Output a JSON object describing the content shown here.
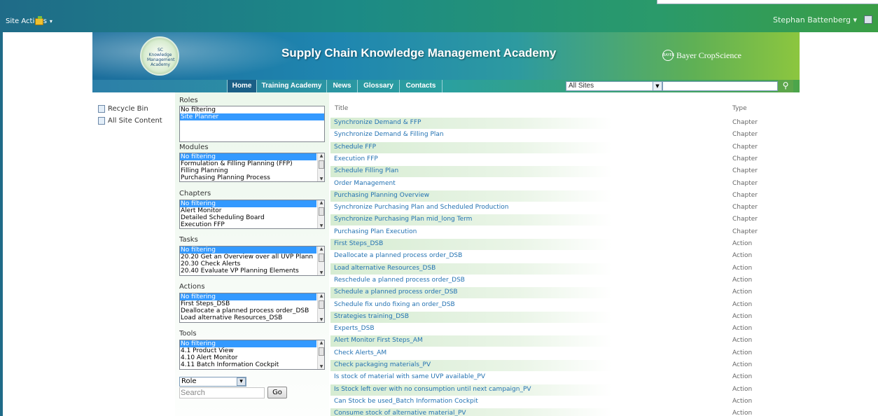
{
  "topbar": {
    "site_actions": "Site Actions",
    "user": "Stephan Battenberg"
  },
  "banner": {
    "title": "Supply Chain Knowledge Management Academy",
    "logo_text": "SC Knowledge Management Academy",
    "brand": "Bayer CropScience"
  },
  "nav": {
    "items": [
      "Home",
      "Training Academy",
      "News",
      "Glossary",
      "Contacts"
    ],
    "active": "Home",
    "scope_value": "All Sites"
  },
  "left_links": [
    "Recycle Bin",
    "All Site Content"
  ],
  "filters": {
    "roles": {
      "label": "Roles",
      "options": [
        "No filtering",
        "Site Planner"
      ],
      "selected": "Site Planner"
    },
    "modules": {
      "label": "Modules",
      "options": [
        "No filtering",
        "Formulation & Filling Planning (FFP)",
        "Filling Planning",
        "Purchasing Planning Process"
      ],
      "selected": "No filtering"
    },
    "chapters": {
      "label": "Chapters",
      "options": [
        "No filtering",
        "Alert Monitor",
        "Detailed Scheduling Board",
        "Execution FFP"
      ],
      "selected": "No filtering"
    },
    "tasks": {
      "label": "Tasks",
      "options": [
        "No filtering",
        "20.20 Get an Overview over all UVP Plann",
        "20.30 Check Alerts",
        "20.40 Evaluate VP Planning Elements"
      ],
      "selected": "No filtering"
    },
    "actions": {
      "label": "Actions",
      "options": [
        "No filtering",
        "First Steps_DSB",
        "Deallocate a planned process order_DSB",
        "Load alternative Resources_DSB"
      ],
      "selected": "No filtering"
    },
    "tools": {
      "label": "Tools",
      "options": [
        "No filtering",
        "4.1 Product View",
        "4.10 Alert Monitor",
        "4.11 Batch Information Cockpit"
      ],
      "selected": "No filtering"
    },
    "role_select": "Role",
    "search_placeholder": "Search",
    "go_label": "Go"
  },
  "table": {
    "headers": {
      "title": "Title",
      "type": "Type"
    },
    "rows": [
      {
        "title": "Synchronize Demand & FFP",
        "type": "Chapter"
      },
      {
        "title": "Synchronize Demand & Filling Plan",
        "type": "Chapter"
      },
      {
        "title": "Schedule FFP",
        "type": "Chapter"
      },
      {
        "title": "Execution FFP",
        "type": "Chapter"
      },
      {
        "title": "Schedule Filling Plan",
        "type": "Chapter"
      },
      {
        "title": "Order Management",
        "type": "Chapter"
      },
      {
        "title": "Purchasing Planning Overview",
        "type": "Chapter"
      },
      {
        "title": "Synchronize Purchasing Plan and Scheduled Production",
        "type": "Chapter"
      },
      {
        "title": "Synchronize Purchasing Plan mid_long Term",
        "type": "Chapter"
      },
      {
        "title": "Purchasing Plan Execution",
        "type": "Chapter"
      },
      {
        "title": "First Steps_DSB",
        "type": "Action"
      },
      {
        "title": "Deallocate a planned process order_DSB",
        "type": "Action"
      },
      {
        "title": "Load alternative Resources_DSB",
        "type": "Action"
      },
      {
        "title": "Reschedule a planned process order_DSB",
        "type": "Action"
      },
      {
        "title": "Schedule a planned process order_DSB",
        "type": "Action"
      },
      {
        "title": "Schedule fix undo fixing an order_DSB",
        "type": "Action"
      },
      {
        "title": "Strategies training_DSB",
        "type": "Action"
      },
      {
        "title": "Experts_DSB",
        "type": "Action"
      },
      {
        "title": "Alert Monitor First Steps_AM",
        "type": "Action"
      },
      {
        "title": "Check Alerts_AM",
        "type": "Action"
      },
      {
        "title": "Check packaging materials_PV",
        "type": "Action"
      },
      {
        "title": "Is stock of material with same UVP available_PV",
        "type": "Action"
      },
      {
        "title": "Is Stock left over with no consumption until next campaign_PV",
        "type": "Action"
      },
      {
        "title": "Can Stock be used_Batch Information Cockpit",
        "type": "Action"
      },
      {
        "title": "Consume stock of alternative material_PV",
        "type": "Action"
      }
    ]
  }
}
